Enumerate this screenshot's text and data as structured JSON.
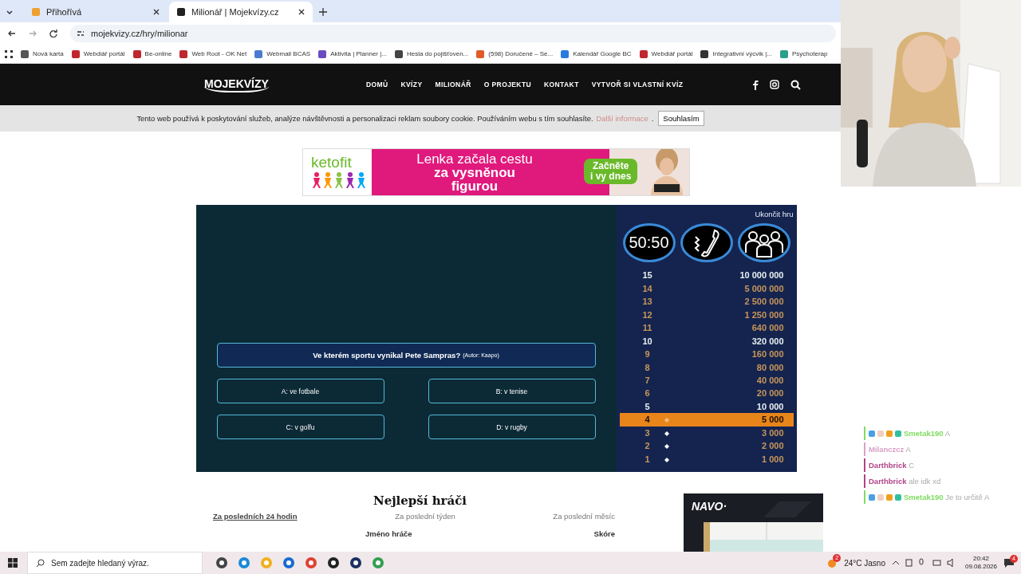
{
  "browser": {
    "tabs": [
      {
        "title": "Přihořívá",
        "selected": false
      },
      {
        "title": "Milionář | Mojekvízy.cz",
        "selected": true
      }
    ],
    "address": "mojekvizy.cz/hry/milionar",
    "bookmarks": [
      {
        "label": "Nová karta",
        "color": "#555555"
      },
      {
        "label": "Webdiář portál",
        "color": "#c0262d"
      },
      {
        "label": "Be-online",
        "color": "#c0262d"
      },
      {
        "label": "Web Root - OK Net",
        "color": "#c0262d"
      },
      {
        "label": "Webmail BCAS",
        "color": "#4a7bd0"
      },
      {
        "label": "Aktivita | Planner |...",
        "color": "#6a4cc0"
      },
      {
        "label": "Hesla do pojišťoven...",
        "color": "#444444"
      },
      {
        "label": "(598) Doručené – Se...",
        "color": "#e05a2a"
      },
      {
        "label": "Kalendář Google BC",
        "color": "#2a7be0"
      },
      {
        "label": "Webdiář portál",
        "color": "#c0262d"
      },
      {
        "label": "Integrativní výcvik |...",
        "color": "#333333"
      },
      {
        "label": "Psychoterap",
        "color": "#2aa08a"
      }
    ]
  },
  "site": {
    "logo": "MOJEKVÍZY",
    "nav": [
      "DOMŮ",
      "KVÍZY",
      "MILIONÁŘ",
      "O PROJEKTU",
      "KONTAKT",
      "VYTVOŘ SI VLASTNÍ KVÍZ"
    ],
    "cookie": {
      "text": "Tento web používá k poskytování služeb, analýze návštěvnosti a personalizaci reklam soubory cookie. Používáním webu s tím souhlasíte.",
      "link": "Další informace",
      "after_link": ".",
      "button": "Souhlasím"
    }
  },
  "ad_banner": {
    "brand": "ketofit",
    "headline_1": "Lenka začala cestu",
    "headline_2": "za vysněnou",
    "headline_3": "figurou",
    "cta_1": "Začněte",
    "cta_2": "i vy dnes"
  },
  "game": {
    "quit": "Ukončit hru",
    "question": "Ve kterém sportu vynikal Pete Sampras?",
    "author": "(Autor: Kaapo)",
    "answers": [
      "A: ve fotbale",
      "B: v tenise",
      "C: v golfu",
      "D: v rugby"
    ],
    "lifelines": [
      {
        "kind": "fifty",
        "label": "50:50"
      },
      {
        "kind": "phone"
      },
      {
        "kind": "audience"
      }
    ],
    "ladder": [
      {
        "level": "15",
        "amount": "10 000 000",
        "milestone": true,
        "current": false,
        "passed": false
      },
      {
        "level": "14",
        "amount": "5 000 000",
        "milestone": false,
        "current": false,
        "passed": false
      },
      {
        "level": "13",
        "amount": "2 500 000",
        "milestone": false,
        "current": false,
        "passed": false
      },
      {
        "level": "12",
        "amount": "1 250 000",
        "milestone": false,
        "current": false,
        "passed": false
      },
      {
        "level": "11",
        "amount": "640 000",
        "milestone": false,
        "current": false,
        "passed": false
      },
      {
        "level": "10",
        "amount": "320 000",
        "milestone": true,
        "current": false,
        "passed": false
      },
      {
        "level": "9",
        "amount": "160 000",
        "milestone": false,
        "current": false,
        "passed": false
      },
      {
        "level": "8",
        "amount": "80 000",
        "milestone": false,
        "current": false,
        "passed": false
      },
      {
        "level": "7",
        "amount": "40 000",
        "milestone": false,
        "current": false,
        "passed": false
      },
      {
        "level": "6",
        "amount": "20 000",
        "milestone": false,
        "current": false,
        "passed": false
      },
      {
        "level": "5",
        "amount": "10 000",
        "milestone": true,
        "current": false,
        "passed": false
      },
      {
        "level": "4",
        "amount": "5 000",
        "milestone": false,
        "current": true,
        "passed": true
      },
      {
        "level": "3",
        "amount": "3 000",
        "milestone": false,
        "current": false,
        "passed": true
      },
      {
        "level": "2",
        "amount": "2 000",
        "milestone": false,
        "current": false,
        "passed": true
      },
      {
        "level": "1",
        "amount": "1 000",
        "milestone": false,
        "current": false,
        "passed": true
      }
    ]
  },
  "leaderboard": {
    "title": "Nejlepší hráči",
    "periods": [
      {
        "label": "Za posledních 24 hodin",
        "selected": true
      },
      {
        "label": "Za poslední týden",
        "selected": false
      },
      {
        "label": "Za poslední měsíc",
        "selected": false
      }
    ],
    "columns": [
      "Jméno hráče",
      "Skóre"
    ]
  },
  "side_ad": {
    "brand": "NAVO·"
  },
  "chat": [
    {
      "user": "Smetak190",
      "text": "A",
      "color": "#7fdc5f",
      "badges": true
    },
    {
      "user": "Milanczcz",
      "text": "A",
      "color": "#d9a0c8",
      "badges": false
    },
    {
      "user": "Darthbrick",
      "text": "C",
      "color": "#b04488",
      "badges": false
    },
    {
      "user": "Darthbrick",
      "text": "ale idk xd",
      "color": "#b04488",
      "badges": false
    },
    {
      "user": "Smetak190",
      "text": "Je to určitě A",
      "color": "#7fdc5f",
      "badges": true
    }
  ],
  "taskbar": {
    "search_placeholder": "Sem zadejte hledaný výraz.",
    "weather_alert": "2",
    "weather": "24°C  Jasno",
    "time": "20:42",
    "date": "09.08.2026",
    "notifications": "4"
  }
}
